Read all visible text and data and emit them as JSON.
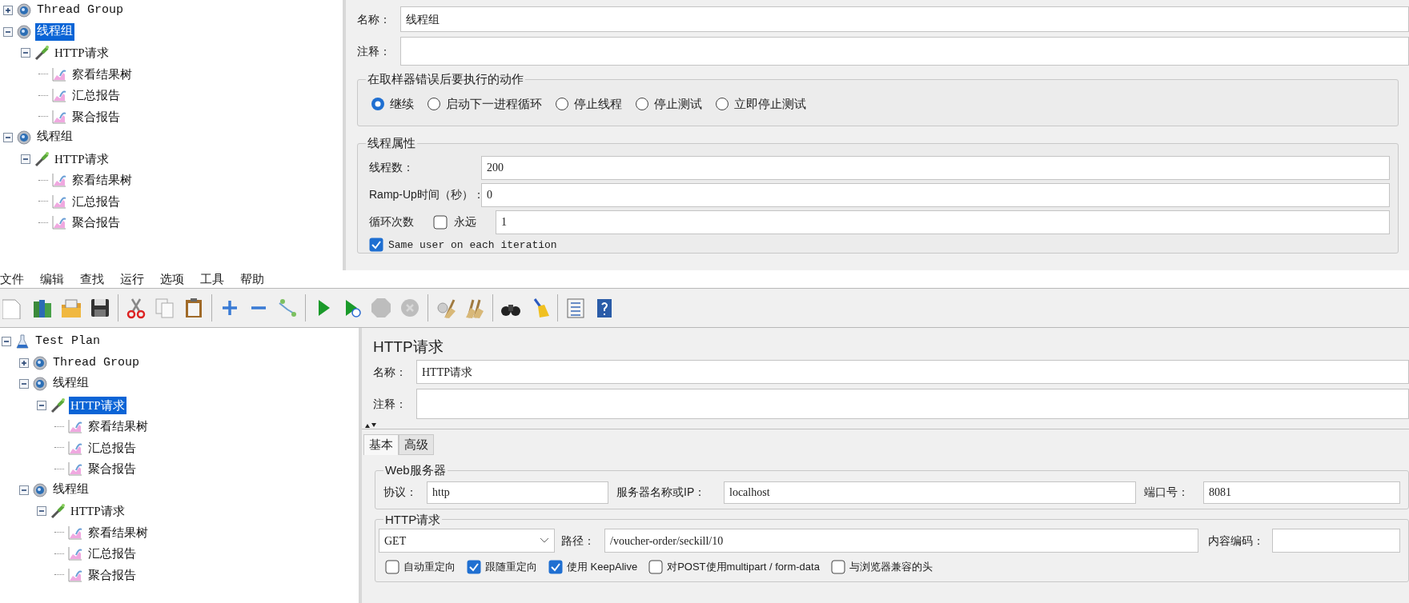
{
  "top_tree": [
    {
      "label": "Thread Group",
      "kind": "thread-group",
      "expanded": false,
      "selected": false
    },
    {
      "label": "线程组",
      "kind": "thread-group",
      "expanded": true,
      "selected": true,
      "children": [
        {
          "label": "HTTP请求",
          "kind": "sampler",
          "expanded": true,
          "selected": false,
          "children": [
            {
              "label": "察看结果树",
              "kind": "listener",
              "selected": false
            },
            {
              "label": "汇总报告",
              "kind": "listener",
              "selected": false
            },
            {
              "label": "聚合报告",
              "kind": "listener",
              "selected": false
            }
          ]
        }
      ]
    },
    {
      "label": "线程组",
      "kind": "thread-group",
      "expanded": true,
      "selected": false,
      "children": [
        {
          "label": "HTTP请求",
          "kind": "sampler",
          "expanded": true,
          "selected": false,
          "children": [
            {
              "label": "察看结果树",
              "kind": "listener",
              "selected": false
            },
            {
              "label": "汇总报告",
              "kind": "listener",
              "selected": false
            },
            {
              "label": "聚合报告",
              "kind": "listener",
              "selected": false
            }
          ]
        }
      ]
    }
  ],
  "thread_group_panel": {
    "name": {
      "label": "名称：",
      "value": "线程组"
    },
    "comment": {
      "label": "注释："
    },
    "error_action": {
      "title": "在取样器错误后要执行的动作",
      "options": [
        {
          "label": "继续",
          "selected": true
        },
        {
          "label": "启动下一进程循环",
          "selected": false
        },
        {
          "label": "停止线程",
          "selected": false
        },
        {
          "label": "停止测试",
          "selected": false
        },
        {
          "label": "立即停止测试",
          "selected": false
        }
      ]
    },
    "thread_properties": {
      "title": "线程属性",
      "threads": {
        "label": "线程数：",
        "value": "200"
      },
      "ramp_up": {
        "label": "Ramp-Up时间（秒）：",
        "value": "0"
      },
      "loop": {
        "label": "循环次数",
        "forever": {
          "label": "永远",
          "checked": false
        },
        "value": "1"
      },
      "same_user": {
        "label": "Same user on each iteration",
        "checked": true
      }
    }
  },
  "menu": [
    "文件",
    "编辑",
    "查找",
    "运行",
    "选项",
    "工具",
    "帮助"
  ],
  "bottom_tree": [
    {
      "label": "Test Plan",
      "kind": "test-plan",
      "expanded": true,
      "selected": false,
      "children": [
        {
          "label": "Thread Group",
          "kind": "thread-group",
          "expanded": false,
          "selected": false
        },
        {
          "label": "线程组",
          "kind": "thread-group",
          "expanded": true,
          "selected": false,
          "children": [
            {
              "label": "HTTP请求",
              "kind": "sampler",
              "expanded": true,
              "selected": true,
              "children": [
                {
                  "label": "察看结果树",
                  "kind": "listener",
                  "selected": false
                },
                {
                  "label": "汇总报告",
                  "kind": "listener",
                  "selected": false
                },
                {
                  "label": "聚合报告",
                  "kind": "listener",
                  "selected": false
                }
              ]
            }
          ]
        },
        {
          "label": "线程组",
          "kind": "thread-group",
          "expanded": true,
          "selected": false,
          "children": [
            {
              "label": "HTTP请求",
              "kind": "sampler",
              "expanded": true,
              "selected": false,
              "children": [
                {
                  "label": "察看结果树",
                  "kind": "listener",
                  "selected": false
                },
                {
                  "label": "汇总报告",
                  "kind": "listener",
                  "selected": false
                },
                {
                  "label": "聚合报告",
                  "kind": "listener",
                  "selected": false
                }
              ]
            }
          ]
        }
      ]
    }
  ],
  "http_panel": {
    "title": "HTTP请求",
    "name": {
      "label": "名称：",
      "value": "HTTP请求"
    },
    "comment": {
      "label": "注释："
    },
    "tabs": [
      {
        "label": "基本",
        "selected": true
      },
      {
        "label": "高级",
        "selected": false
      }
    ],
    "web_server": {
      "title": "Web服务器",
      "protocol": {
        "label": "协议：",
        "value": "http"
      },
      "server": {
        "label": "服务器名称或IP：",
        "value": "localhost"
      },
      "port": {
        "label": "端口号：",
        "value": "8081"
      }
    },
    "request": {
      "title": "HTTP请求",
      "method": "GET",
      "path": {
        "label": "路径：",
        "value": "/voucher-order/seckill/10"
      },
      "encoding": {
        "label": "内容编码："
      },
      "options": [
        {
          "label": "自动重定向",
          "checked": false
        },
        {
          "label": "跟随重定向",
          "checked": true
        },
        {
          "label": "使用 KeepAlive",
          "checked": true
        },
        {
          "label": "对POST使用multipart / form-data",
          "checked": false
        },
        {
          "label": "与浏览器兼容的头",
          "checked": false
        }
      ]
    }
  }
}
